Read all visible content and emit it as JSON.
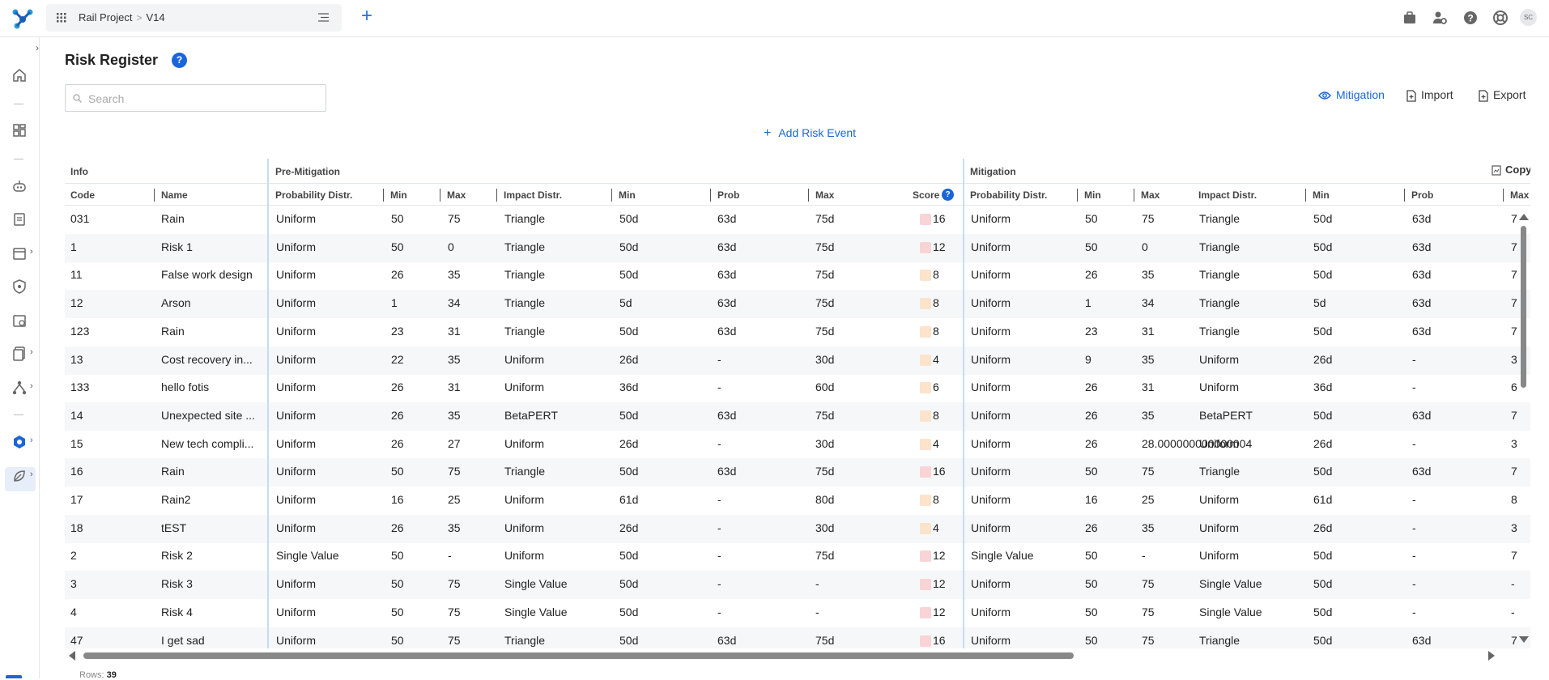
{
  "topbar": {
    "project": "Rail Project",
    "version": "V14",
    "avatar_initials": "SC",
    "add_symbol": "+"
  },
  "colors": {
    "accent": "#1a66d9",
    "score_high": "#f9d4d6",
    "score_mid": "#fce3cc",
    "group_line": "#c8dbf5"
  },
  "page": {
    "title": "Risk Register",
    "help_symbol": "?",
    "search_placeholder": "Search",
    "actions": {
      "mitigation": "Mitigation",
      "import": "Import",
      "export": "Export"
    },
    "add_risk": "Add Risk Event",
    "rows_label": "Rows:",
    "rows_count": "39"
  },
  "table": {
    "groups": {
      "info": "Info",
      "pre": "Pre-Mitigation",
      "mit": "Mitigation",
      "copy": "Copy"
    },
    "headers": {
      "code": "Code",
      "name": "Name",
      "pre_prob": "Probability Distr.",
      "pre_min": "Min",
      "pre_max": "Max",
      "pre_impact": "Impact Distr.",
      "pre_imin": "Min",
      "pre_iprob": "Prob",
      "pre_imax": "Max",
      "score": "Score",
      "mit_prob": "Probability Distr.",
      "mit_min": "Min",
      "mit_max": "Max",
      "mit_impact": "Impact Distr.",
      "mit_imin": "Min",
      "mit_iprob": "Prob",
      "mit_imax": "Max"
    },
    "rows": [
      {
        "code": "031",
        "name": "Rain",
        "pd": "Uniform",
        "pmin": "50",
        "pmax": "75",
        "id": "Triangle",
        "imin": "50d",
        "iprob": "63d",
        "imax": "75d",
        "level": "high",
        "score": "16",
        "mpd": "Uniform",
        "mmin": "50",
        "mmax": "75",
        "mid": "Triangle",
        "mimin": "50d",
        "miprob": "63d",
        "mimax": "7"
      },
      {
        "code": "1",
        "name": "Risk 1",
        "pd": "Uniform",
        "pmin": "50",
        "pmax": "0",
        "id": "Triangle",
        "imin": "50d",
        "iprob": "63d",
        "imax": "75d",
        "level": "high",
        "score": "12",
        "mpd": "Uniform",
        "mmin": "50",
        "mmax": "0",
        "mid": "Triangle",
        "mimin": "50d",
        "miprob": "63d",
        "mimax": "7"
      },
      {
        "code": "11",
        "name": "False work design",
        "pd": "Uniform",
        "pmin": "26",
        "pmax": "35",
        "id": "Triangle",
        "imin": "50d",
        "iprob": "63d",
        "imax": "75d",
        "level": "mid",
        "score": "8",
        "mpd": "Uniform",
        "mmin": "26",
        "mmax": "35",
        "mid": "Triangle",
        "mimin": "50d",
        "miprob": "63d",
        "mimax": "7"
      },
      {
        "code": "12",
        "name": "Arson",
        "pd": "Uniform",
        "pmin": "1",
        "pmax": "34",
        "id": "Triangle",
        "imin": "5d",
        "iprob": "63d",
        "imax": "75d",
        "level": "mid",
        "score": "8",
        "mpd": "Uniform",
        "mmin": "1",
        "mmax": "34",
        "mid": "Triangle",
        "mimin": "5d",
        "miprob": "63d",
        "mimax": "7"
      },
      {
        "code": "123",
        "name": "Rain",
        "pd": "Uniform",
        "pmin": "23",
        "pmax": "31",
        "id": "Triangle",
        "imin": "50d",
        "iprob": "63d",
        "imax": "75d",
        "level": "mid",
        "score": "8",
        "mpd": "Uniform",
        "mmin": "23",
        "mmax": "31",
        "mid": "Triangle",
        "mimin": "50d",
        "miprob": "63d",
        "mimax": "7"
      },
      {
        "code": "13",
        "name": "Cost recovery in...",
        "pd": "Uniform",
        "pmin": "22",
        "pmax": "35",
        "id": "Uniform",
        "imin": "26d",
        "iprob": "-",
        "imax": "30d",
        "level": "mid",
        "score": "4",
        "mpd": "Uniform",
        "mmin": "9",
        "mmax": "35",
        "mid": "Uniform",
        "mimin": "26d",
        "miprob": "-",
        "mimax": "3"
      },
      {
        "code": "133",
        "name": "hello fotis",
        "pd": "Uniform",
        "pmin": "26",
        "pmax": "31",
        "id": "Uniform",
        "imin": "36d",
        "iprob": "-",
        "imax": "60d",
        "level": "mid",
        "score": "6",
        "mpd": "Uniform",
        "mmin": "26",
        "mmax": "31",
        "mid": "Uniform",
        "mimin": "36d",
        "miprob": "-",
        "mimax": "6"
      },
      {
        "code": "14",
        "name": "Unexpected site ...",
        "pd": "Uniform",
        "pmin": "26",
        "pmax": "35",
        "id": "BetaPERT",
        "imin": "50d",
        "iprob": "63d",
        "imax": "75d",
        "level": "mid",
        "score": "8",
        "mpd": "Uniform",
        "mmin": "26",
        "mmax": "35",
        "mid": "BetaPERT",
        "mimin": "50d",
        "miprob": "63d",
        "mimax": "7"
      },
      {
        "code": "15",
        "name": "New tech compli...",
        "pd": "Uniform",
        "pmin": "26",
        "pmax": "27",
        "id": "Uniform",
        "imin": "26d",
        "iprob": "-",
        "imax": "30d",
        "level": "mid",
        "score": "4",
        "mpd": "Uniform",
        "mmin": "26",
        "mmax": "28.000000000000004",
        "mid": "Uniform",
        "mimin": "26d",
        "miprob": "-",
        "mimax": "3"
      },
      {
        "code": "16",
        "name": "Rain",
        "pd": "Uniform",
        "pmin": "50",
        "pmax": "75",
        "id": "Triangle",
        "imin": "50d",
        "iprob": "63d",
        "imax": "75d",
        "level": "high",
        "score": "16",
        "mpd": "Uniform",
        "mmin": "50",
        "mmax": "75",
        "mid": "Triangle",
        "mimin": "50d",
        "miprob": "63d",
        "mimax": "7"
      },
      {
        "code": "17",
        "name": "Rain2",
        "pd": "Uniform",
        "pmin": "16",
        "pmax": "25",
        "id": "Uniform",
        "imin": "61d",
        "iprob": "-",
        "imax": "80d",
        "level": "mid",
        "score": "8",
        "mpd": "Uniform",
        "mmin": "16",
        "mmax": "25",
        "mid": "Uniform",
        "mimin": "61d",
        "miprob": "-",
        "mimax": "8"
      },
      {
        "code": "18",
        "name": "tEST",
        "pd": "Uniform",
        "pmin": "26",
        "pmax": "35",
        "id": "Uniform",
        "imin": "26d",
        "iprob": "-",
        "imax": "30d",
        "level": "mid",
        "score": "4",
        "mpd": "Uniform",
        "mmin": "26",
        "mmax": "35",
        "mid": "Uniform",
        "mimin": "26d",
        "miprob": "-",
        "mimax": "3"
      },
      {
        "code": "2",
        "name": "Risk 2",
        "pd": "Single Value",
        "pmin": "50",
        "pmax": "-",
        "id": "Uniform",
        "imin": "50d",
        "iprob": "-",
        "imax": "75d",
        "level": "high",
        "score": "12",
        "mpd": "Single Value",
        "mmin": "50",
        "mmax": "-",
        "mid": "Uniform",
        "mimin": "50d",
        "miprob": "-",
        "mimax": "7"
      },
      {
        "code": "3",
        "name": "Risk 3",
        "pd": "Uniform",
        "pmin": "50",
        "pmax": "75",
        "id": "Single Value",
        "imin": "50d",
        "iprob": "-",
        "imax": "-",
        "level": "high",
        "score": "12",
        "mpd": "Uniform",
        "mmin": "50",
        "mmax": "75",
        "mid": "Single Value",
        "mimin": "50d",
        "miprob": "-",
        "mimax": "-"
      },
      {
        "code": "4",
        "name": "Risk 4",
        "pd": "Uniform",
        "pmin": "50",
        "pmax": "75",
        "id": "Single Value",
        "imin": "50d",
        "iprob": "-",
        "imax": "-",
        "level": "high",
        "score": "12",
        "mpd": "Uniform",
        "mmin": "50",
        "mmax": "75",
        "mid": "Single Value",
        "mimin": "50d",
        "miprob": "-",
        "mimax": "-"
      },
      {
        "code": "47",
        "name": "I get sad",
        "pd": "Uniform",
        "pmin": "50",
        "pmax": "75",
        "id": "Triangle",
        "imin": "50d",
        "iprob": "63d",
        "imax": "75d",
        "level": "high",
        "score": "16",
        "mpd": "Uniform",
        "mmin": "50",
        "mmax": "75",
        "mid": "Triangle",
        "mimin": "50d",
        "miprob": "63d",
        "mimax": "7"
      }
    ]
  }
}
